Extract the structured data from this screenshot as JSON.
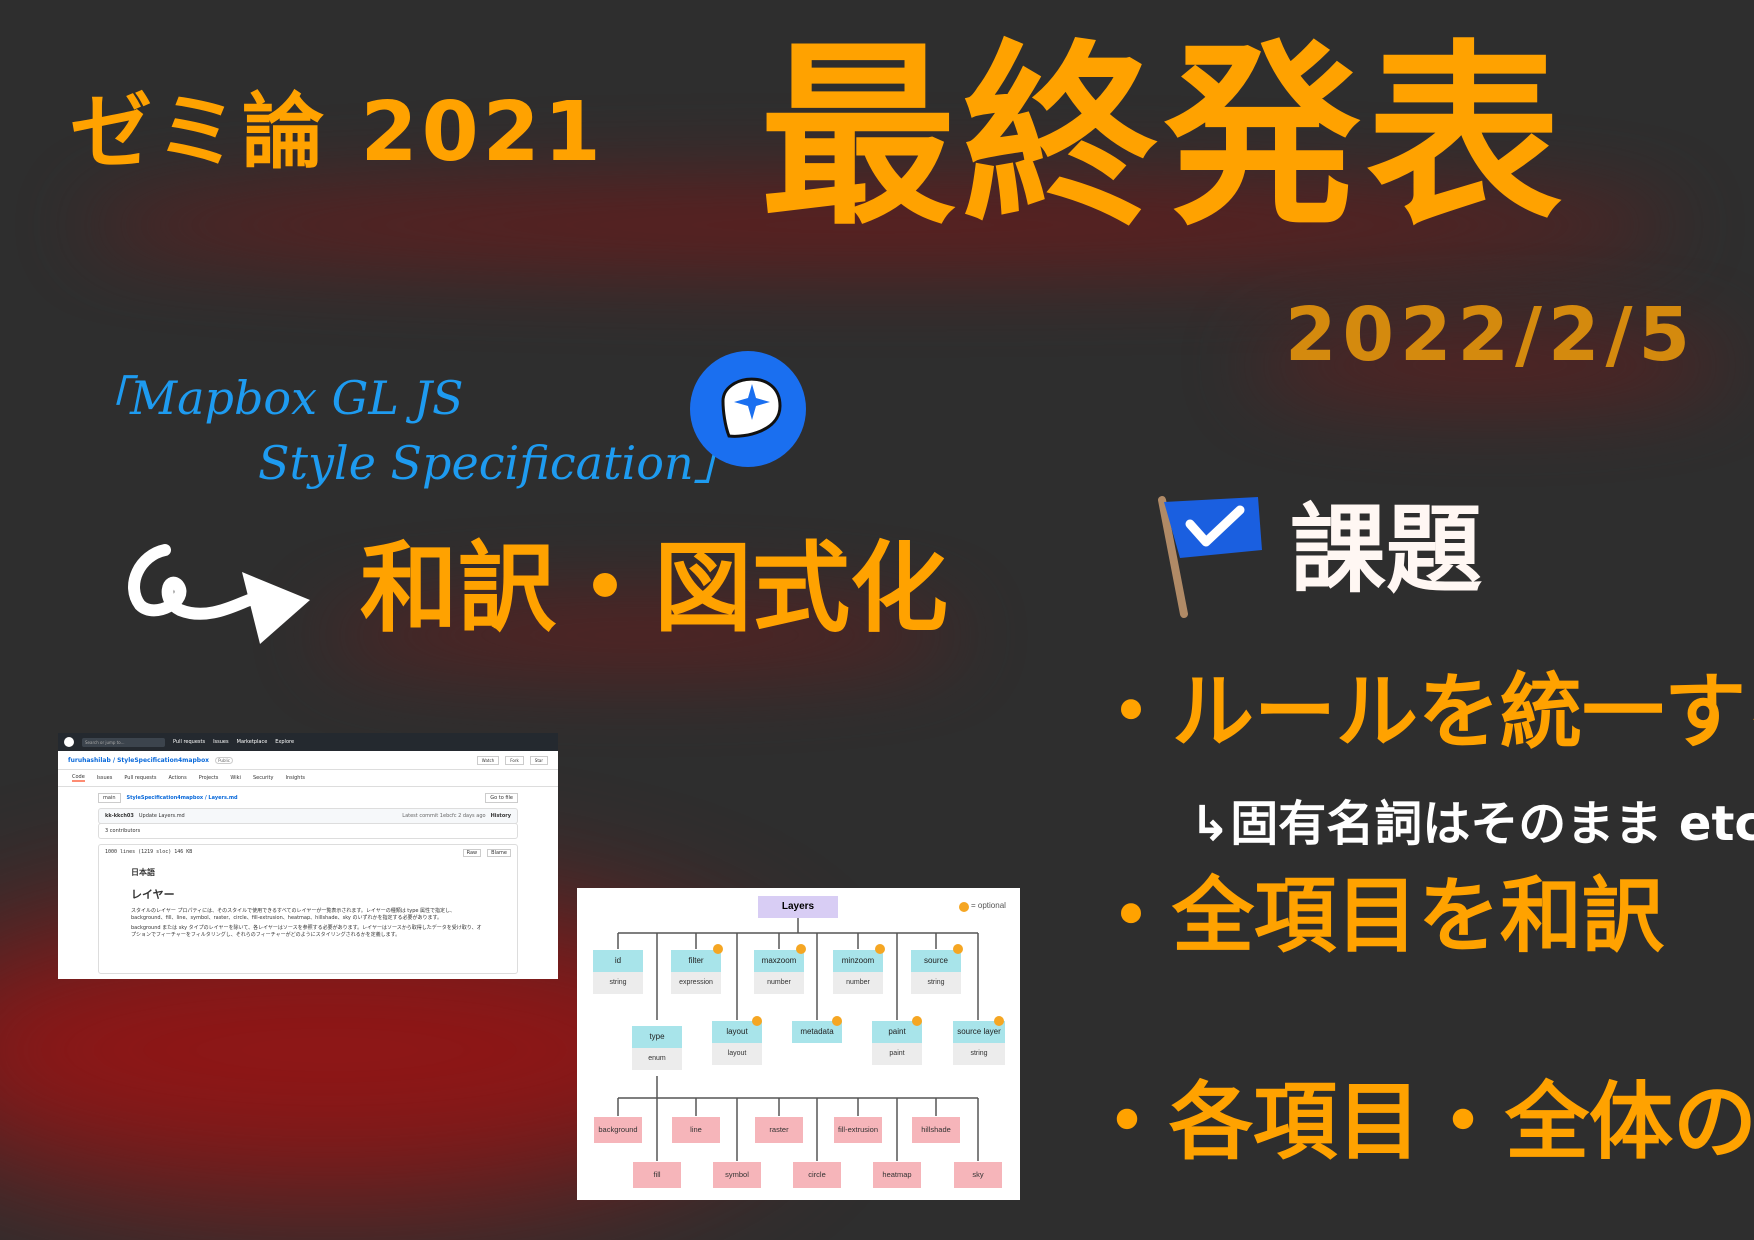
{
  "colors": {
    "background": "#2e2e2e",
    "accent": "#ffa200",
    "subject": "#1e9bf0",
    "glow_red": "#8b1414"
  },
  "slide": {
    "title_left": "ゼミ論 2021",
    "title_main": "最終発表",
    "date": "2022/2/5",
    "subject_line1": "「Mapbox GL JS",
    "subject_line2": "Style Specification」",
    "task": "和訳・図式化",
    "issues_heading": "課題",
    "bullet1": "・ルールを統一する",
    "bullet1_note": "↳固有名詞はそのまま etc…",
    "bullet2": "・全項目を和訳",
    "bullet3": "・各項目・全体の図式化"
  },
  "screenshot": {
    "search": "Search or jump to...",
    "nav": [
      "Pull requests",
      "Issues",
      "Marketplace",
      "Explore"
    ],
    "repo": "furuhashilab / StyleSpecification4mapbox",
    "repo_badge": "Public",
    "repo_actions": [
      "Watch",
      "Fork",
      "Star"
    ],
    "tabs": [
      "Code",
      "Issues",
      "Pull requests",
      "Actions",
      "Projects",
      "Wiki",
      "Security",
      "Insights"
    ],
    "branch": "main",
    "path": "StyleSpecification4mapbox / Layers.md",
    "go_to_file": "Go to file",
    "commit_user": "kk-kkch03",
    "commit_msg": "Update Layers.md",
    "commit_meta": "Latest commit 1ebcfc 2 days ago",
    "history": "History",
    "contributors": "3 contributors",
    "file_info": "1000 lines (1219 sloc)  146 KB",
    "file_actions": [
      "Raw",
      "Blame"
    ],
    "h_lang": "日本語",
    "h_title": "レイヤー",
    "p1": "スタイルのレイヤー プロパティには、そのスタイルで使用できるすべてのレイヤーが一覧表示されます。レイヤーの種類は type 属性で指定し、background、fill、line、symbol、raster、circle、fill-extrusion、heatmap、hillshade、sky のいずれかを指定する必要があります。",
    "p2": "background または sky タイプのレイヤーを除いて、各レイヤーはソースを参照する必要があります。レイヤーはソースから取得したデータを受け取り、オプションでフィーチャーをフィルタリングし、それらのフィーチャーがどのようにスタイリングされるかを定義します。"
  },
  "diagram": {
    "root": "Layers",
    "legend": "= optional",
    "row1": [
      {
        "name": "id",
        "type": "string",
        "optional": false
      },
      {
        "name": "filter",
        "type": "expression",
        "optional": true
      },
      {
        "name": "maxzoom",
        "type": "number",
        "optional": true
      },
      {
        "name": "minzoom",
        "type": "number",
        "optional": true
      },
      {
        "name": "source",
        "type": "string",
        "optional": true
      }
    ],
    "row2": [
      {
        "name": "type",
        "type": "enum",
        "optional": false
      },
      {
        "name": "layout",
        "type": "layout",
        "optional": true
      },
      {
        "name": "metadata",
        "type": "",
        "optional": true
      },
      {
        "name": "paint",
        "type": "paint",
        "optional": true
      },
      {
        "name": "source layer",
        "type": "string",
        "optional": true
      }
    ],
    "types_top": [
      "background",
      "line",
      "raster",
      "fill-extrusion",
      "hillshade"
    ],
    "types_bottom": [
      "fill",
      "symbol",
      "circle",
      "heatmap",
      "sky"
    ]
  }
}
